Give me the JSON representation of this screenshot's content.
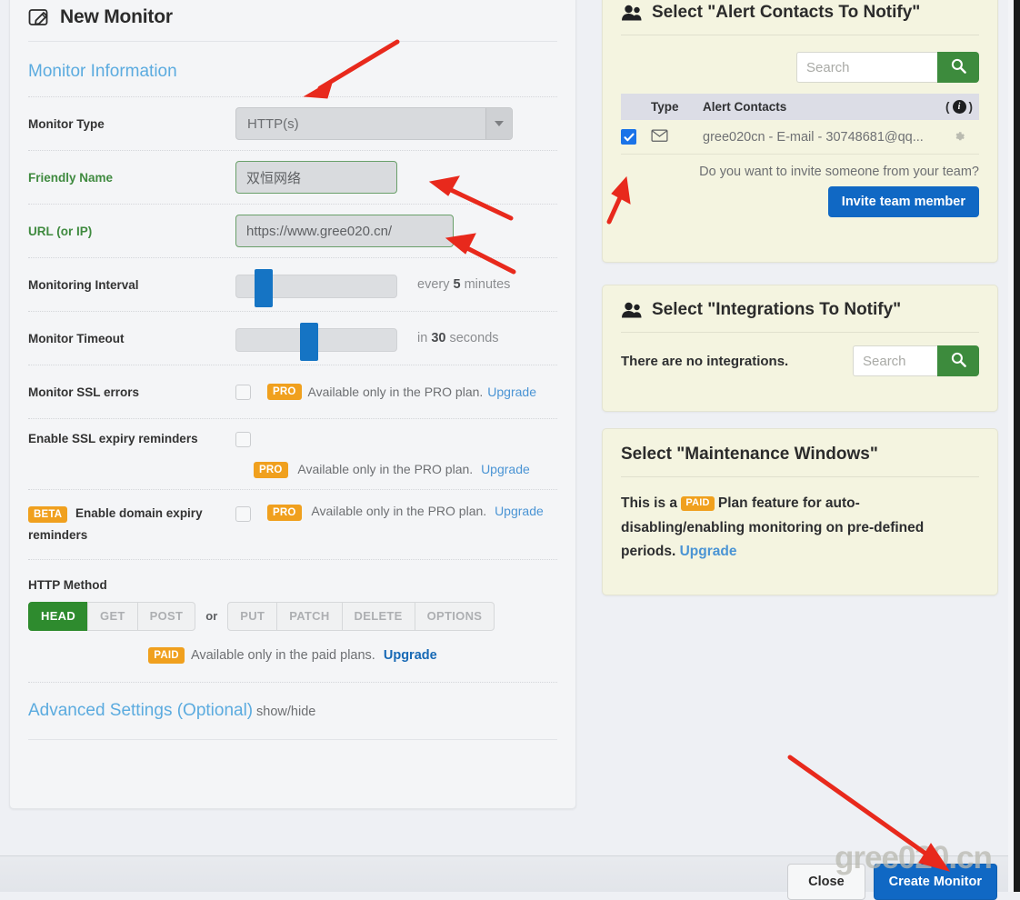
{
  "modal": {
    "title": "New Monitor",
    "icon": "pencil-square-icon"
  },
  "left_form": {
    "section_title": "Monitor Information",
    "monitor_type": {
      "label": "Monitor Type",
      "value": "HTTP(s)",
      "caret_icon": "chevron-down-icon"
    },
    "friendly_name": {
      "label": "Friendly Name",
      "value": "双恒网络"
    },
    "url": {
      "label": "URL (or IP)",
      "value": "https://www.gree020.cn/"
    },
    "monitoring_interval": {
      "label": "Monitoring Interval",
      "note_prefix": "every ",
      "note_value": "5",
      "note_suffix": " minutes",
      "handle_percent": 13
    },
    "monitor_timeout": {
      "label": "Monitor Timeout",
      "note_prefix": "in ",
      "note_value": "30",
      "note_suffix": " seconds",
      "handle_percent": 45
    },
    "monitor_ssl_errors": {
      "label": "Monitor SSL errors",
      "checked": false,
      "badge": "PRO",
      "note": "Available only in the PRO plan.",
      "link": "Upgrade"
    },
    "ssl_expiry_reminders": {
      "label": "Enable SSL expiry reminders",
      "checked": false,
      "badge": "PRO",
      "note": "Available only in the PRO plan.",
      "link": "Upgrade"
    },
    "domain_expiry_reminders": {
      "beta_badge": "BETA",
      "label": "Enable domain expiry reminders",
      "checked": false,
      "badge": "PRO",
      "note": "Available only in the PRO plan.",
      "link": "Upgrade"
    },
    "http_method": {
      "label": "HTTP Method",
      "primary_methods": [
        "HEAD",
        "GET",
        "POST"
      ],
      "separator": "or",
      "secondary_methods": [
        "PUT",
        "PATCH",
        "DELETE",
        "OPTIONS"
      ],
      "selected": "HEAD",
      "paid_badge": "PAID",
      "paid_note": "Available only in the paid plans.",
      "paid_link": "Upgrade"
    },
    "advanced": {
      "link": "Advanced Settings (Optional)",
      "toggle": "show/hide"
    }
  },
  "alert_contacts_panel": {
    "icon": "people-icon",
    "title": "Select \"Alert Contacts To Notify\"",
    "search_placeholder": "Search",
    "search_icon": "magnifier-icon",
    "columns": {
      "type": "Type",
      "name": "Alert Contacts",
      "info_open": "(",
      "info_icon": "info-icon",
      "info_close": ")"
    },
    "rows": [
      {
        "checked": true,
        "type_icon": "envelope-icon",
        "name": "gree020cn - E-mail - 30748681@qq...",
        "settings_icon": "gear-icon"
      }
    ],
    "invite_text": "Do you want to invite someone from your team?",
    "invite_button": "Invite team member"
  },
  "integrations_panel": {
    "icon": "people-icon",
    "title": "Select \"Integrations To Notify\"",
    "empty_text": "There are no integrations.",
    "search_placeholder": "Search",
    "search_icon": "magnifier-icon"
  },
  "maintenance_panel": {
    "title": "Select \"Maintenance Windows\"",
    "text_before_badge": "This is a ",
    "badge": "PAID",
    "text_after_badge": " Plan feature for auto-disabling/enabling monitoring on pre-defined periods. ",
    "link": "Upgrade"
  },
  "footer": {
    "close_label": "Close",
    "create_label": "Create Monitor"
  },
  "watermark": {
    "text": "gree020.cn"
  },
  "colors": {
    "accent_blue": "#1068c4",
    "link_blue": "#4a94d4",
    "section_blue": "#5babdf",
    "green": "#3d8b3d",
    "badge_orange": "#f0a01e",
    "panel_cream": "#f4f4e0",
    "page_bg": "#eef0f4",
    "annotation_red": "#e8291c"
  }
}
